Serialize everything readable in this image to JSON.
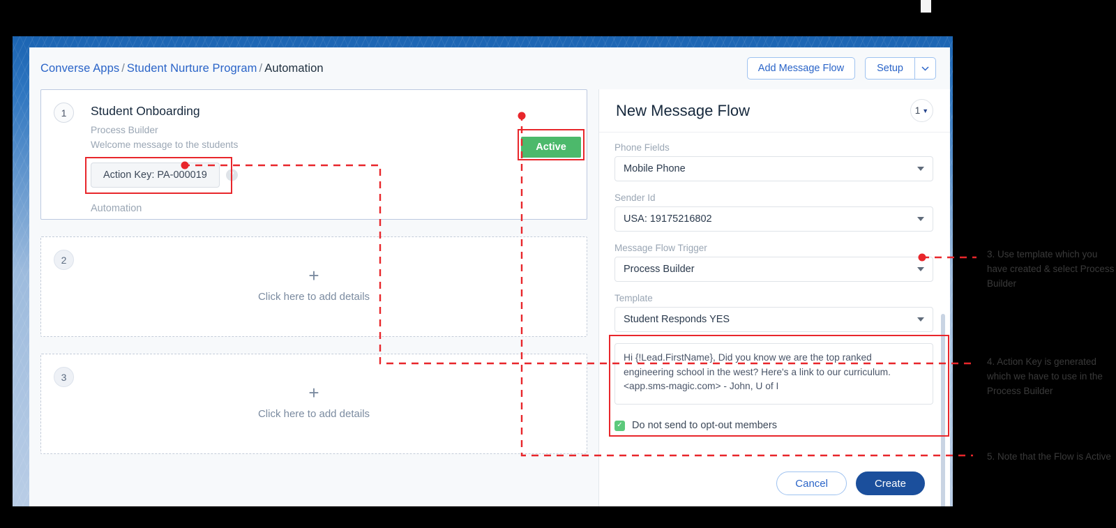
{
  "breadcrumb": {
    "item1": "Converse Apps",
    "sep1": "/",
    "item2": "Student Nurture Program",
    "sep2": "/",
    "current": "Automation"
  },
  "toolbar": {
    "add_message_flow": "Add Message Flow",
    "setup": "Setup",
    "setup_caret_icon": "chevron-down-icon"
  },
  "automation": {
    "steps": [
      {
        "number": "1",
        "title": "Student Onboarding",
        "subtitle": "Process Builder",
        "description": "Welcome message to the students",
        "action_key": "Action Key: PA-000019",
        "help_icon": "question-mark-icon",
        "footer_label": "Automation"
      },
      {
        "number": "2",
        "plus_icon": "plus-icon",
        "empty_text": "Click here to add details"
      },
      {
        "number": "3",
        "plus_icon": "plus-icon",
        "empty_text": "Click here to add details"
      }
    ],
    "status_badge": "Active"
  },
  "panel": {
    "title": "New Message Flow",
    "count": "1",
    "count_caret_icon": "chevron-down-icon",
    "fields": [
      {
        "label": "Phone Fields",
        "value": "Mobile Phone"
      },
      {
        "label": "Sender Id",
        "value": "USA: 19175216802"
      },
      {
        "label": "Message Flow Trigger",
        "value": "Process Builder"
      },
      {
        "label": "Template",
        "value": "Student Responds YES"
      }
    ],
    "message_text": "Hi {!Lead.FirstName}, Did you know we are the top ranked engineering school in the west? Here's a link to our curriculum. <app.sms-magic.com> - John, U of I",
    "checkbox": {
      "checked_icon": "check-icon",
      "label": "Do not send to opt-out members"
    },
    "cancel": "Cancel",
    "create": "Create"
  },
  "annotations": [
    {
      "id": "3",
      "text": "3. Use template which you have created & select Process Builder"
    },
    {
      "id": "4",
      "text": "4. Action Key is generated which we have to use in the Process Builder"
    },
    {
      "id": "5",
      "text": "5. Note that the Flow is Active"
    }
  ],
  "colors": {
    "accent_blue": "#2a64c8",
    "annotation_red": "#e8262b",
    "active_green": "#4cb96b",
    "create_button": "#1b4f9c"
  }
}
